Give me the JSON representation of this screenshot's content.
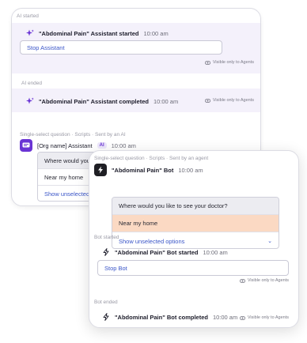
{
  "back_card": {
    "ai_started": {
      "section_label": "AI started",
      "title": "\"Abdominal Pain\" Assistant started",
      "time": "10:00 am",
      "stop_label": "Stop Assistant",
      "visibility": "Visible only to Agents",
      "icon": "sparkle-icon"
    },
    "ai_ended": {
      "section_label": "AI ended",
      "title": "\"Abdominal Pain\" Assistant completed",
      "time": "10:00 am",
      "visibility": "Visible only to Agents",
      "icon": "sparkle-icon"
    },
    "question": {
      "section_label": "Single-select question · Scripts · Sent by an AI",
      "sender": "[Org name] Assistant",
      "badge": "AI",
      "time": "10:00 am",
      "question_text": "Where would you like to see your doctor?",
      "selected_option": "Near my home",
      "show_unselected": "Show unselected options"
    }
  },
  "front_card": {
    "question": {
      "section_label": "Single-select question · Scripts · Sent by an agent",
      "sender": "\"Abdominal Pain\" Bot",
      "time": "10:00 am",
      "question_text": "Where would you like to see your doctor?",
      "selected_option": "Near my home",
      "show_unselected": "Show unselected options"
    },
    "bot_started": {
      "section_label": "Bot started",
      "title": "\"Abdominal Pain\" Bot started",
      "time": "10:00 am",
      "stop_label": "Stop Bot",
      "visibility": "Visible only to Agents",
      "icon": "bolt-icon"
    },
    "bot_ended": {
      "section_label": "Bot ended",
      "title": "\"Abdominal Pain\" Bot completed",
      "time": "10:00 am",
      "visibility": "Visible only to Agents",
      "icon": "bolt-icon"
    }
  },
  "colors": {
    "accent_purple": "#6a34d4",
    "band_lavender": "#f4f1fb",
    "selected_option": "#fbd9c3",
    "link_blue": "#3a55c8"
  }
}
